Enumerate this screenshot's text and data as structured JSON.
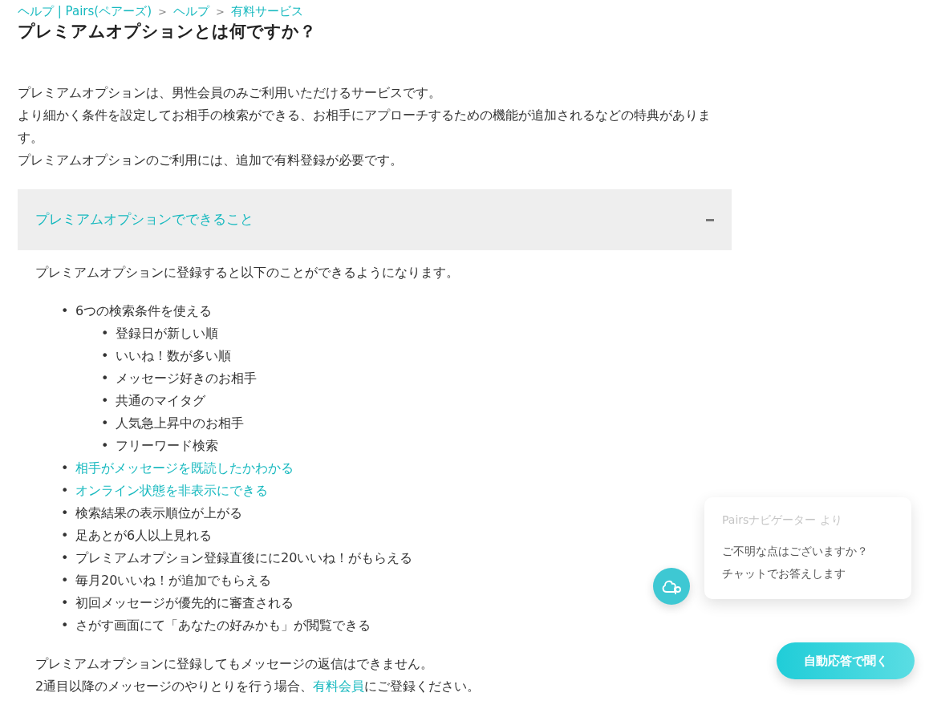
{
  "breadcrumb": [
    {
      "label": "ヘルプ | Pairs(ペアーズ)"
    },
    {
      "label": "ヘルプ"
    },
    {
      "label": "有料サービス"
    }
  ],
  "breadcrumb_separator": ">",
  "title": "プレミアムオプションとは何ですか？",
  "intro": [
    "プレミアムオプションは、男性会員のみご利用いただけるサービスです。",
    "より細かく条件を設定してお相手の検索ができる、お相手にアプローチするための機能が追加されるなどの特典があります。",
    "プレミアムオプションのご利用には、追加で有料登録が必要です。"
  ],
  "accordion": {
    "title": "プレミアムオプションでできること",
    "expanded": true,
    "marker": "•",
    "lead": "プレミアムオプションに登録すると以下のことができるようになります。",
    "features": [
      {
        "label": "6つの検索条件を使える",
        "kind": "text",
        "children": [
          {
            "label": "登録日が新しい順",
            "kind": "text"
          },
          {
            "label": "いいね！数が多い順",
            "kind": "text"
          },
          {
            "label": "メッセージ好きのお相手",
            "kind": "text"
          },
          {
            "label": "共通のマイタグ",
            "kind": "text"
          },
          {
            "label": "人気急上昇中のお相手",
            "kind": "text"
          },
          {
            "label": "フリーワード検索",
            "kind": "text"
          }
        ]
      },
      {
        "label": "相手がメッセージを既読したかわかる",
        "kind": "link"
      },
      {
        "label": "オンライン状態を非表示にできる",
        "kind": "link"
      },
      {
        "label": "検索結果の表示順位が上がる",
        "kind": "text"
      },
      {
        "label": "足あとが6人以上見れる",
        "kind": "text"
      },
      {
        "label": "プレミアムオプション登録直後にに20いいね！がもらえる",
        "kind": "text"
      },
      {
        "label": "毎月20いいね！が追加でもらえる",
        "kind": "text"
      },
      {
        "label": "初回メッセージが優先的に審査される",
        "kind": "text"
      },
      {
        "label": "さがす画面にて「あなたの好みかも」が閲覧できる",
        "kind": "text"
      }
    ],
    "note": "プレミアムオプションに登録してもメッセージの返信はできません。",
    "note2": {
      "before": "2通目以降のメッセージのやりとりを行う場合、",
      "link": "有料会員",
      "after": "にご登録ください。"
    }
  },
  "chat": {
    "from": "Pairsナビゲーター より",
    "lines": [
      "ご不明な点はございますか？",
      "チャットでお答えします"
    ],
    "button": "自動応答で聞く"
  }
}
